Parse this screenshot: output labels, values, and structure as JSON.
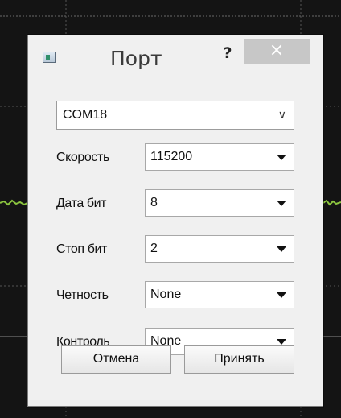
{
  "window": {
    "title": "Порт",
    "help_label": "?",
    "close_label": "×"
  },
  "port": {
    "value": "COM18"
  },
  "fields": [
    {
      "label": "Скорость",
      "value": "115200"
    },
    {
      "label": "Дата бит",
      "value": "8"
    },
    {
      "label": "Стоп бит",
      "value": "2"
    },
    {
      "label": "Четность",
      "value": "None"
    },
    {
      "label": "Контроль",
      "value": "None"
    }
  ],
  "buttons": {
    "cancel_label": "Отмена",
    "accept_label": "Принять"
  },
  "colors": {
    "background": "#141414",
    "signal": "#8cc63f",
    "dialog": "#f0f0f0",
    "close_button": "#c7c7c7"
  }
}
